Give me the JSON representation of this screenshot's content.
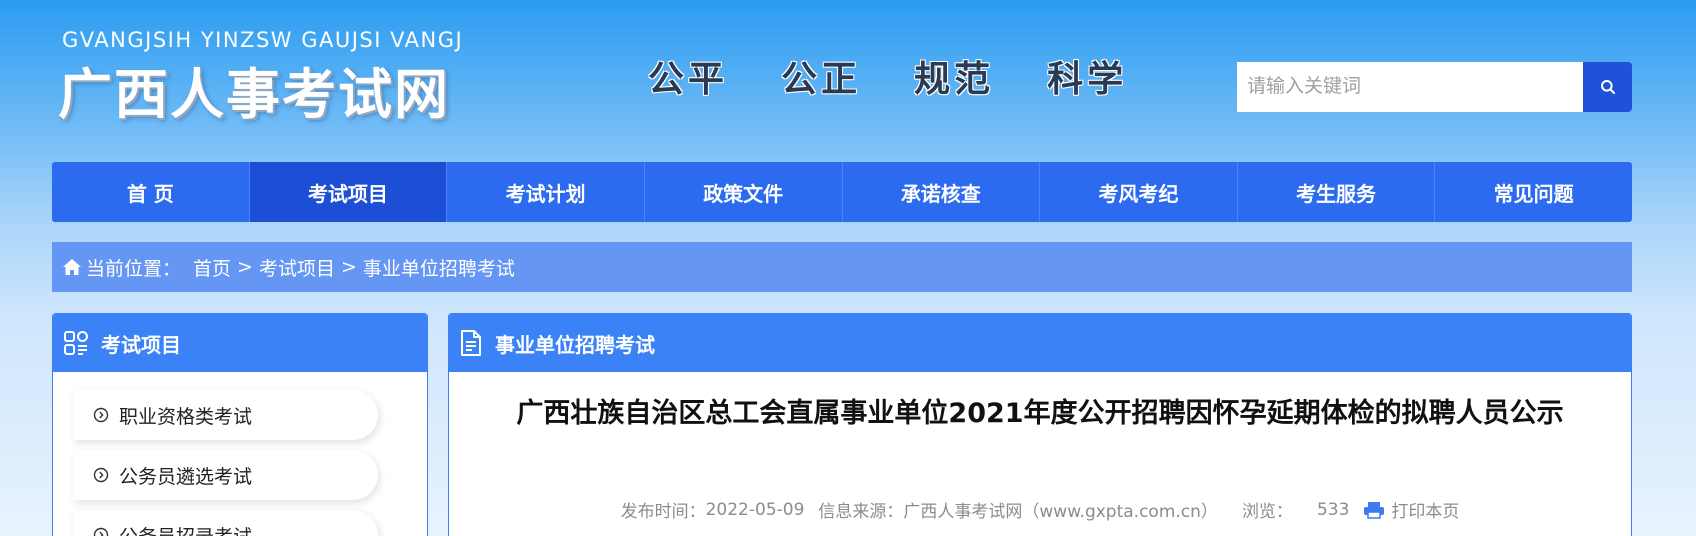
{
  "header": {
    "logo_pinyin": "GVANGJSIH YINZSW GAUJSI VANGJ",
    "logo_cn": "广西人事考试网",
    "slogan": "公平  公正  规范  科学",
    "search": {
      "placeholder": "请输入关键词",
      "value": "",
      "button_icon": "search-icon"
    }
  },
  "nav": {
    "items": [
      {
        "label": "首 页"
      },
      {
        "label": "考试项目"
      },
      {
        "label": "考试计划"
      },
      {
        "label": "政策文件"
      },
      {
        "label": "承诺核查"
      },
      {
        "label": "考风考纪"
      },
      {
        "label": "考生服务"
      },
      {
        "label": "常见问题"
      }
    ],
    "active_index": 1
  },
  "breadcrumb": {
    "prefix": "当前位置：",
    "items": [
      "首页",
      "考试项目",
      "事业单位招聘考试"
    ],
    "separator": ">"
  },
  "sidebar": {
    "title": "考试项目",
    "items": [
      {
        "label": "职业资格类考试"
      },
      {
        "label": "公务员遴选考试"
      },
      {
        "label": "公务员招录考试"
      }
    ]
  },
  "main": {
    "title": "事业单位招聘考试",
    "article": {
      "title": "广西壮族自治区总工会直属事业单位2021年度公开招聘因怀孕延期体检的拟聘人员公示",
      "publish_label": "发布时间：",
      "publish_date": "2022-05-09",
      "source_label": "信息来源：",
      "source": "广西人事考试网（www.gxpta.com.cn）",
      "views_label": "浏览：",
      "views": "533",
      "print_label": "打印本页"
    }
  },
  "colors": {
    "nav_bg": "#2c6bf0",
    "nav_active": "#1d4fd6",
    "panel_head": "#3b82f6",
    "breadcrumb_bg": "#6696f4",
    "search_btn": "#1f52d8"
  }
}
